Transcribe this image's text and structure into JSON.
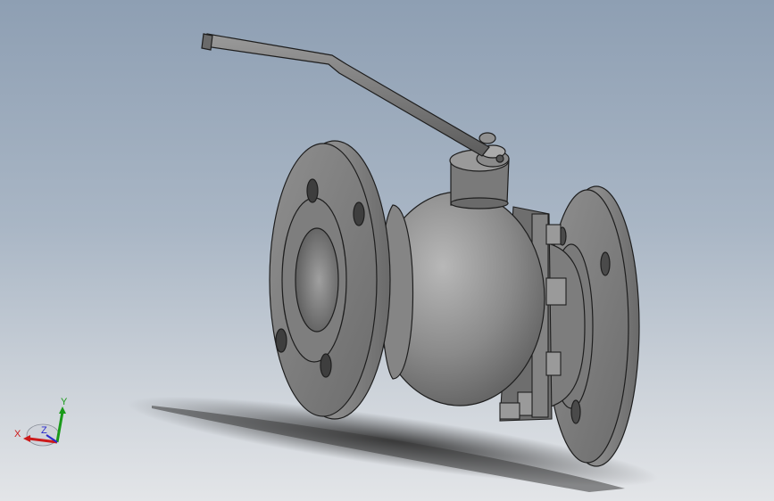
{
  "viewport": {
    "colors": {
      "background_top": "#8e9fb3",
      "background_bottom": "#e3e5e8",
      "model_metal": "#7c7c7c",
      "edge_lines": "#222222"
    }
  },
  "triad": {
    "x_label": "X",
    "y_label": "Y",
    "z_label": "Z",
    "colors": {
      "x": "#cc1a1a",
      "y": "#1a9a1a",
      "z": "#2a2acc"
    }
  }
}
